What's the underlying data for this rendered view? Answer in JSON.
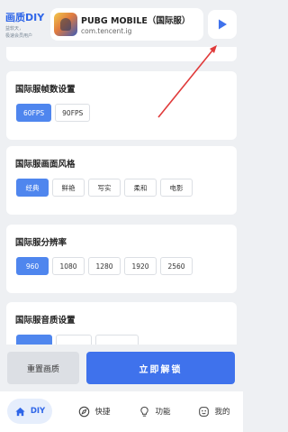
{
  "header": {
    "brand_title": "画质DIY",
    "brand_sub_line1": "益软天，",
    "brand_sub_line2": "极速会员用户",
    "app_name": "PUBG MOBILE（国际服）",
    "app_package": "com.tencent.ig",
    "play_icon": "play-icon"
  },
  "sections": [
    {
      "title": "",
      "options": []
    },
    {
      "title": "国际服帧数设置",
      "options": [
        {
          "label": "60FPS",
          "selected": true
        },
        {
          "label": "90FPS",
          "selected": false
        }
      ]
    },
    {
      "title": "国际服画面风格",
      "options": [
        {
          "label": "经典",
          "selected": true
        },
        {
          "label": "鲜艳",
          "selected": false
        },
        {
          "label": "写实",
          "selected": false
        },
        {
          "label": "柔和",
          "selected": false
        },
        {
          "label": "电影",
          "selected": false
        }
      ]
    },
    {
      "title": "国际服分辨率",
      "options": [
        {
          "label": "960",
          "selected": true
        },
        {
          "label": "1080",
          "selected": false
        },
        {
          "label": "1280",
          "selected": false
        },
        {
          "label": "1920",
          "selected": false
        },
        {
          "label": "2560",
          "selected": false
        }
      ]
    },
    {
      "title": "国际服音质设置",
      "options": []
    }
  ],
  "actions": {
    "reset_label": "重置画质",
    "unlock_label": "立即解锁"
  },
  "nav": {
    "items": [
      {
        "label": "DIY",
        "icon": "home-icon",
        "active": true
      },
      {
        "label": "快捷",
        "icon": "compass-icon",
        "active": false
      },
      {
        "label": "功能",
        "icon": "bulb-icon",
        "active": false
      },
      {
        "label": "我的",
        "icon": "face-icon",
        "active": false
      }
    ]
  },
  "colors": {
    "accent": "#3f72ec",
    "selected_option": "#4f86ee",
    "background": "#eef0f3",
    "annotation_arrow": "#e03a3a"
  }
}
